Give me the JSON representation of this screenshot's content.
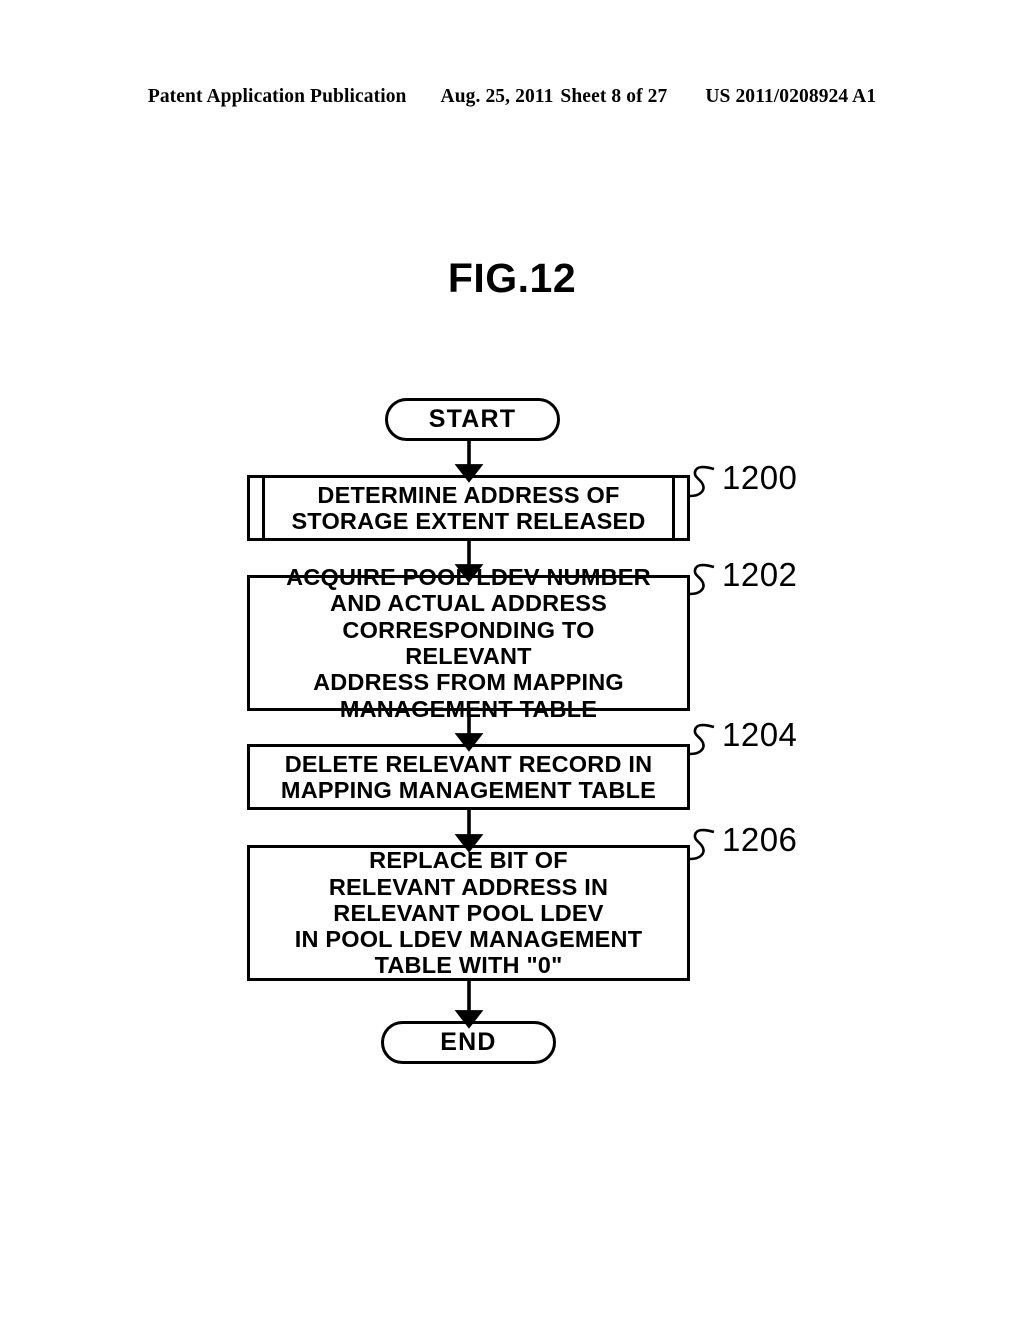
{
  "header": {
    "publication": "Patent Application Publication",
    "date": "Aug. 25, 2011",
    "sheet": "Sheet 8 of 27",
    "doc_number": "US 2011/0208924 A1"
  },
  "figure": {
    "title": "FIG.12"
  },
  "flowchart": {
    "start_label": "START",
    "end_label": "END",
    "steps": [
      {
        "ref": "1200",
        "shape": "predefined-process",
        "text": "DETERMINE ADDRESS OF\nSTORAGE EXTENT RELEASED"
      },
      {
        "ref": "1202",
        "shape": "process",
        "text": "ACQUIRE POOL LDEV NUMBER\nAND ACTUAL ADDRESS\nCORRESPONDING TO RELEVANT\nADDRESS FROM MAPPING\nMANAGEMENT TABLE"
      },
      {
        "ref": "1204",
        "shape": "process",
        "text": "DELETE RELEVANT RECORD IN\nMAPPING MANAGEMENT TABLE"
      },
      {
        "ref": "1206",
        "shape": "process",
        "text": "REPLACE BIT OF\nRELEVANT ADDRESS IN\nRELEVANT POOL LDEV\nIN POOL LDEV MANAGEMENT\nTABLE WITH \"0\""
      }
    ]
  },
  "colors": {
    "ink": "#000000",
    "paper": "#ffffff"
  }
}
